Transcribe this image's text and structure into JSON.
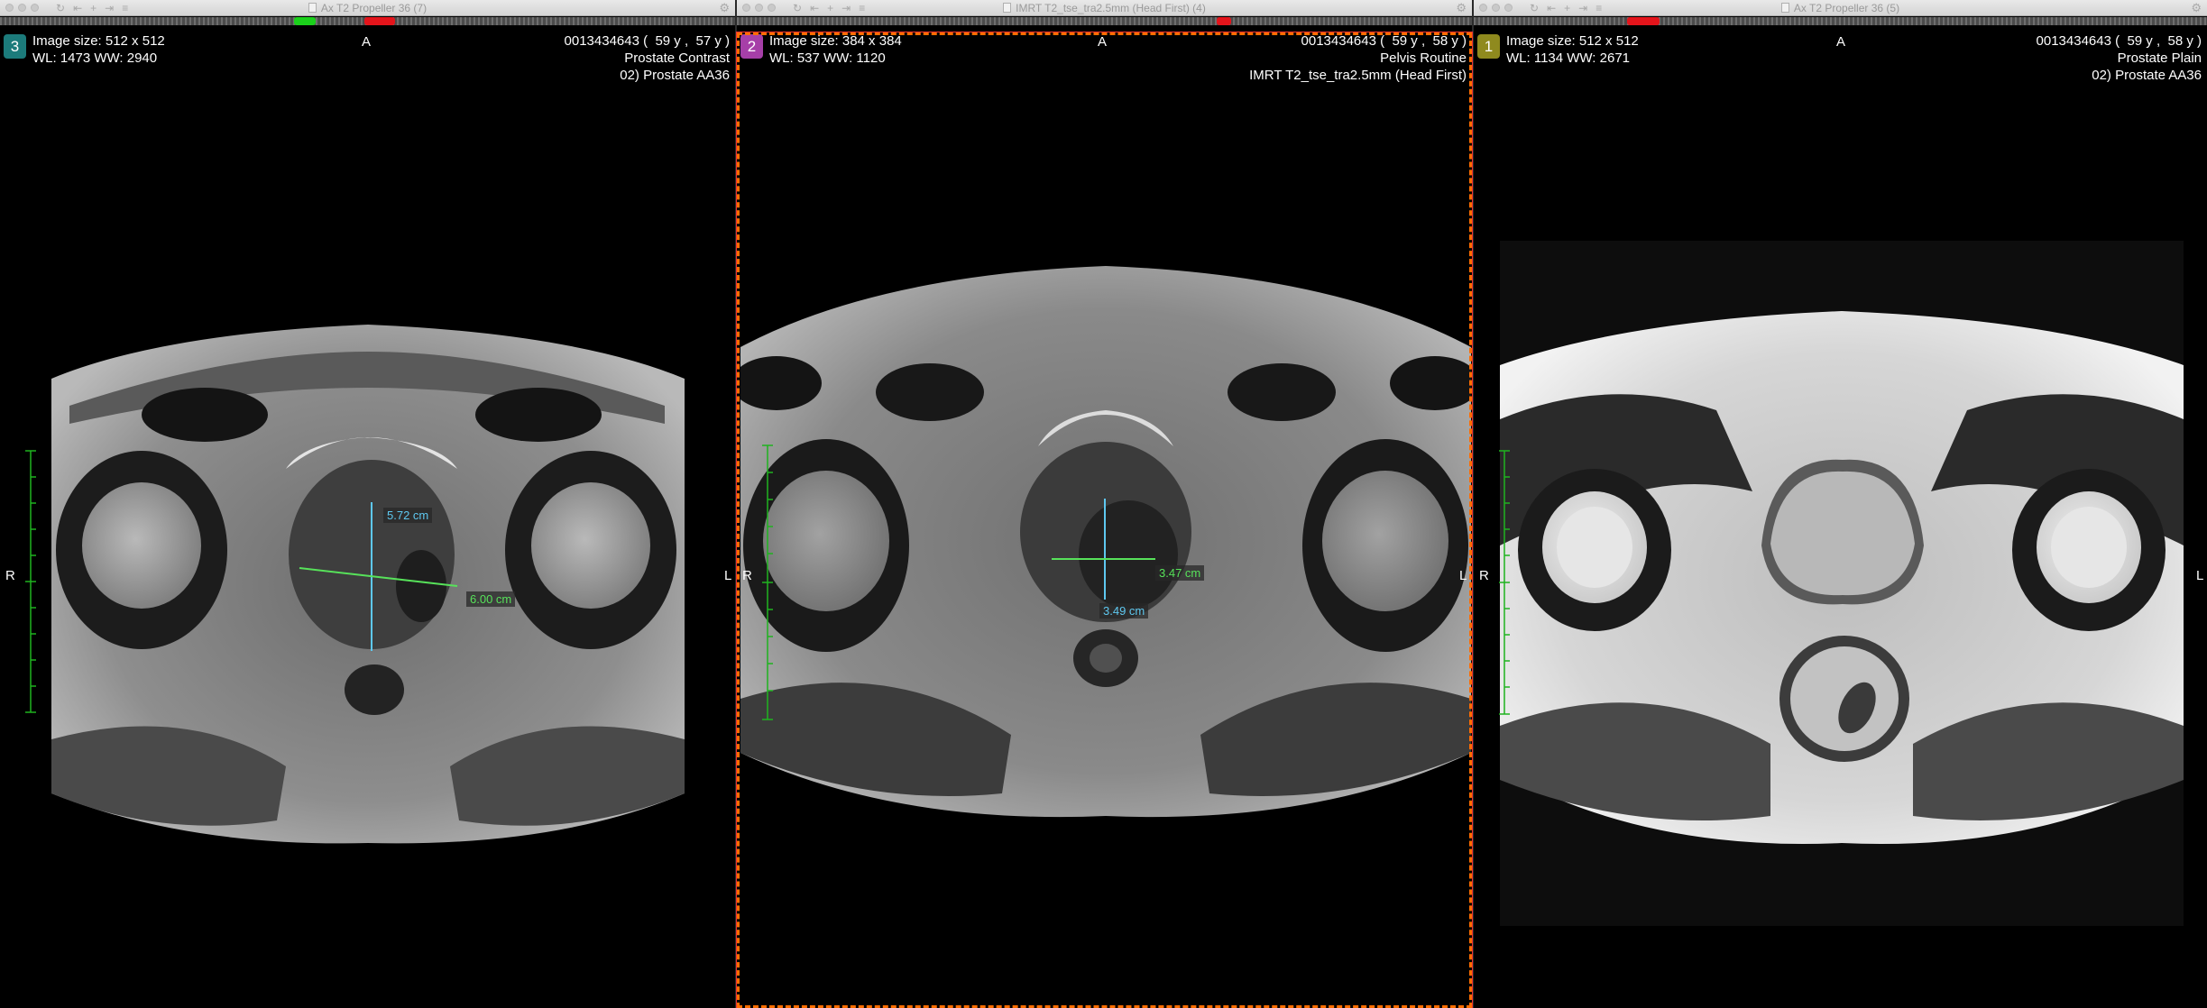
{
  "viewers": [
    {
      "title": "Ax T2 Propeller 36 (7)",
      "series_number": "3",
      "series_color": "#1c7b7b",
      "image_size": "Image size: 512 x 512",
      "window_level": "WL: 1473 WW: 2940",
      "patient_line": "0013434643 (  59 y ,  57 y )",
      "study": "Prostate Contrast",
      "series_desc": "02) Prostate AA36",
      "orient_top": "A",
      "orient_left": "R",
      "orient_right": "L",
      "measurements": [
        {
          "value": "5.72 cm",
          "color": "#5ec8f0"
        },
        {
          "value": "6.00 cm",
          "color": "#57e25a"
        }
      ]
    },
    {
      "title": "IMRT T2_tse_tra2.5mm (Head First) (4)",
      "series_number": "2",
      "series_color": "#a63fa8",
      "image_size": "Image size: 384 x 384",
      "window_level": "WL: 537 WW: 1120",
      "patient_line": "0013434643 (  59 y ,  58 y )",
      "study": "Pelvis Routine",
      "series_desc": "IMRT T2_tse_tra2.5mm (Head First)",
      "orient_top": "A",
      "orient_left": "R",
      "orient_right": "L",
      "measurements": [
        {
          "value": "3.47 cm",
          "color": "#57e25a"
        },
        {
          "value": "3.49 cm",
          "color": "#5ec8f0"
        }
      ]
    },
    {
      "title": "Ax T2 Propeller 36 (5)",
      "series_number": "1",
      "series_color": "#8f8a1e",
      "image_size": "Image size: 512 x 512",
      "window_level": "WL: 1134 WW: 2671",
      "patient_line": "0013434643 (  59 y ,  58 y )",
      "study": "Prostate Plain",
      "series_desc": "02) Prostate AA36",
      "orient_top": "A",
      "orient_left": "R",
      "orient_right": "L",
      "measurements": []
    }
  ],
  "toolbar_icons": [
    "sync-icon",
    "first-icon",
    "add-icon",
    "last-icon",
    "layers-icon"
  ],
  "colors": {
    "active_frame": "#ff6d00",
    "scroll_marker_red": "#e4141b",
    "scroll_marker_green": "#1bd11b",
    "ruler": "#1fb31f"
  }
}
